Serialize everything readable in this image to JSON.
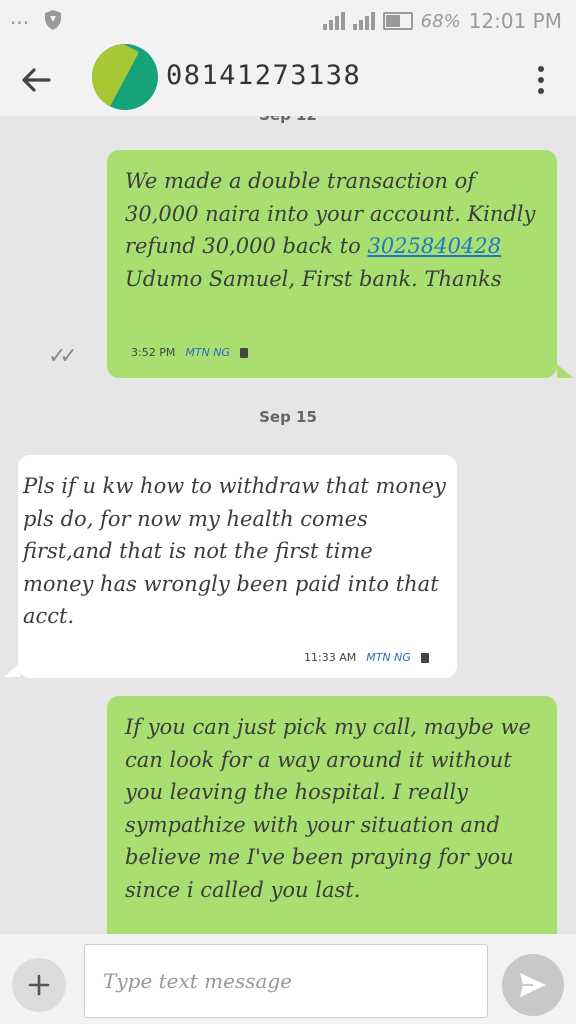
{
  "status_bar": {
    "left_dots": "···",
    "battery_percent": "68%",
    "time": "12:01 PM"
  },
  "header": {
    "contact": "08141273138"
  },
  "conversation": {
    "dates": [
      "Sep 12",
      "Sep 15"
    ],
    "messages": [
      {
        "direction": "sent",
        "text_before_link": "We made a double transaction of 30,000 naira into your account. Kindly refund 30,000 back to ",
        "link": "3025840428",
        "text_after_link": " Udumo Samuel, First bank. Thanks",
        "time": "3:52 PM",
        "carrier": "MTN NG",
        "ticks": "✓✓"
      },
      {
        "direction": "received",
        "text": "Pls if u kw how to withdraw that money pls do, for now my health comes first,and that is not the first time money has wrongly been paid into that acct.",
        "time": "11:33 AM",
        "carrier": "MTN NG"
      },
      {
        "direction": "sent",
        "text": "If you can just pick my call, maybe we can look for a way around it without you leaving the hospital. I really sympathize with your situation and believe me I've been praying for you since i called you last."
      }
    ]
  },
  "composer": {
    "placeholder": "Type text message",
    "attach_icon": "plus-icon",
    "send_icon": "send-icon"
  },
  "colors": {
    "sent_bubble": "#a9df71",
    "received_bubble": "#ffffff",
    "background": "#e6e6e6",
    "link": "#1b78c8",
    "avatar_primary": "#17a37a",
    "avatar_accent": "#a7c734"
  }
}
